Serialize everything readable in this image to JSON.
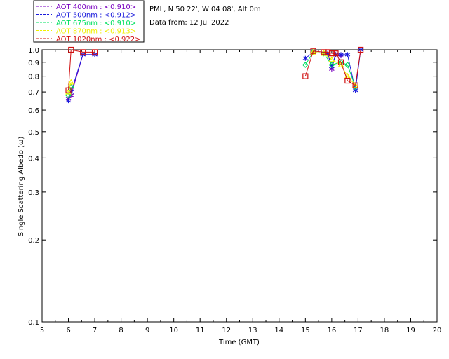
{
  "header": {
    "site": "PML, N 50 22', W 04 08', Alt 0m",
    "date": "Data from: 12 Jul 2022"
  },
  "legend": {
    "position": "top-left",
    "entries": [
      {
        "label": "AOT  400nm : <0.910>",
        "color": "#7a00c0"
      },
      {
        "label": "AOT  500nm : <0.912>",
        "color": "#1a1adc"
      },
      {
        "label": "AOT  675nm : <0.910>",
        "color": "#00e060"
      },
      {
        "label": "AOT  870nm : <0.913>",
        "color": "#f0f000"
      },
      {
        "label": "AOT 1020nm : <0.922>",
        "color": "#d01010"
      }
    ]
  },
  "chart_data": {
    "type": "scatter",
    "xlabel": "Time (GMT)",
    "ylabel": "Single Scattering Albedo (ω)",
    "xlim": [
      5,
      20
    ],
    "ylim": [
      0.1,
      1.0
    ],
    "yscale": "log",
    "xticks": [
      "5",
      "6",
      "7",
      "8",
      "9",
      "10",
      "11",
      "12",
      "13",
      "14",
      "15",
      "16",
      "17",
      "18",
      "19",
      "20"
    ],
    "yticks": [
      {
        "value": 0.1,
        "label": "0.1"
      },
      {
        "value": 0.2,
        "label": "0.2"
      },
      {
        "value": 0.3,
        "label": "0.3"
      },
      {
        "value": 0.4,
        "label": "0.4"
      },
      {
        "value": 0.5,
        "label": "0.5"
      },
      {
        "value": 0.6,
        "label": "0.6"
      },
      {
        "value": 0.7,
        "label": "0.7"
      },
      {
        "value": 0.8,
        "label": "0.8"
      },
      {
        "value": 0.9,
        "label": "0.9"
      },
      {
        "value": 1.0,
        "label": "1.0"
      }
    ],
    "grid": false,
    "series": [
      {
        "name": "AOT  400nm : <0.910>",
        "color": "#7a00c0",
        "marker": "star",
        "x": [
          6.0,
          6.1,
          6.55,
          7.0,
          15.3,
          15.7,
          15.85,
          16.0,
          16.15,
          16.35
        ],
        "y": [
          0.66,
          0.68,
          0.96,
          0.96,
          0.98,
          0.97,
          0.97,
          0.85,
          0.96,
          0.95
        ]
      },
      {
        "name": "AOT  500nm : <0.912>",
        "color": "#1a1adc",
        "marker": "star",
        "x": [
          6.0,
          6.1,
          6.55,
          7.0,
          15.0,
          15.3,
          15.7,
          15.85,
          16.0,
          16.15,
          16.35,
          16.6,
          16.9,
          17.1
        ],
        "y": [
          0.65,
          0.7,
          0.96,
          0.96,
          0.93,
          0.98,
          0.97,
          0.97,
          0.87,
          0.96,
          0.96,
          0.96,
          0.71,
          1.0
        ]
      },
      {
        "name": "AOT  675nm : <0.910>",
        "color": "#00e060",
        "marker": "diamond",
        "x": [
          6.0,
          6.1,
          15.0,
          15.3,
          15.7,
          16.0,
          16.35,
          16.6,
          16.9
        ],
        "y": [
          0.68,
          0.73,
          0.88,
          0.98,
          0.97,
          0.88,
          0.9,
          0.88,
          0.73
        ]
      },
      {
        "name": "AOT  870nm : <0.913>",
        "color": "#f0f000",
        "marker": "triangle",
        "x": [
          6.0,
          6.1,
          15.3,
          15.7,
          16.0,
          16.35,
          16.6,
          16.9
        ],
        "y": [
          0.7,
          0.76,
          0.98,
          0.97,
          0.92,
          0.88,
          0.8,
          0.74
        ]
      },
      {
        "name": "AOT 1020nm : <0.922>",
        "color": "#d01010",
        "marker": "square",
        "x": [
          6.0,
          6.1,
          6.55,
          7.0,
          15.0,
          15.3,
          15.7,
          15.85,
          16.0,
          16.15,
          16.35,
          16.6,
          16.9,
          17.1
        ],
        "y": [
          0.71,
          1.0,
          0.98,
          0.98,
          0.8,
          0.99,
          0.98,
          0.98,
          0.97,
          0.97,
          0.9,
          0.77,
          0.74,
          1.0
        ]
      }
    ]
  }
}
